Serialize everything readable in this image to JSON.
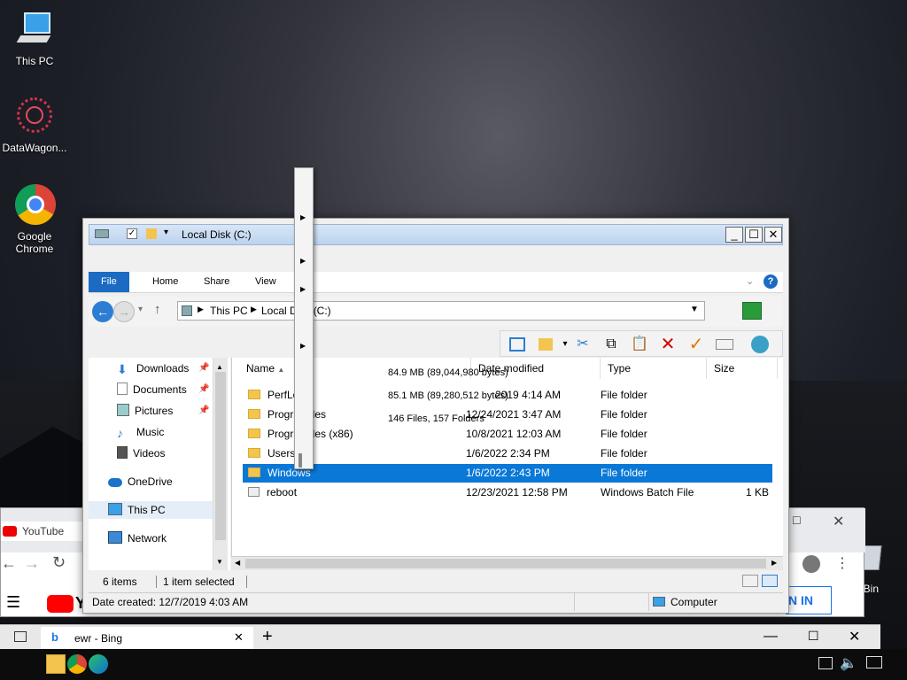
{
  "desktop": {
    "icons": [
      {
        "label": "This PC"
      },
      {
        "label": "DataWagon..."
      },
      {
        "label": "Google\nChrome"
      }
    ],
    "recycle_fragment": "le Bin"
  },
  "chrome_bg": {
    "tab_label": "YouTube",
    "signin_fragment": "N IN",
    "youtube_fragment": "Y"
  },
  "bing_window": {
    "tab_label": "ewr - Bing"
  },
  "explorer": {
    "title": "Local Disk (C:)",
    "ribbon_tabs": [
      "File",
      "Home",
      "Share",
      "View"
    ],
    "breadcrumb": [
      "This PC",
      "Local Disk (C:)"
    ],
    "nav_items": [
      {
        "label": "Downloads",
        "pinned": true,
        "icon": "download-icon"
      },
      {
        "label": "Documents",
        "pinned": true,
        "icon": "documents-icon"
      },
      {
        "label": "Pictures",
        "pinned": true,
        "icon": "pictures-icon"
      },
      {
        "label": "Music",
        "pinned": false,
        "icon": "music-icon"
      },
      {
        "label": "Videos",
        "pinned": false,
        "icon": "videos-icon"
      },
      {
        "label": "OneDrive",
        "pinned": false,
        "icon": "cloud-icon"
      },
      {
        "label": "This PC",
        "pinned": false,
        "icon": "computer-icon"
      },
      {
        "label": "Network",
        "pinned": false,
        "icon": "network-icon"
      }
    ],
    "columns": [
      "Name",
      "Date modified",
      "Type",
      "Size"
    ],
    "files": [
      {
        "name": "PerfLo",
        "date": "2019 4:14 AM",
        "type": "File folder",
        "size": ""
      },
      {
        "name": "Progra",
        "name_tail": "iles",
        "date": "12/24/2021 3:47 AM",
        "type": "File folder",
        "size": ""
      },
      {
        "name": "Progra",
        "name_tail": "iles (x86)",
        "date": "10/8/2021 12:03 AM",
        "type": "File folder",
        "size": ""
      },
      {
        "name": "Users",
        "date": "1/6/2022 2:34 PM",
        "type": "File folder",
        "size": ""
      },
      {
        "name": "Windows",
        "date": "1/6/2022 2:43 PM",
        "type": "File folder",
        "size": "",
        "selected": true
      },
      {
        "name": "reboot",
        "date": "12/23/2021 12:58 PM",
        "type": "Windows Batch File",
        "size": "1 KB"
      }
    ],
    "tooltips": [
      "84.9 MB (89,044,980 bytes)",
      "85.1 MB (89,280,512 bytes)",
      "146 Files, 157 Folders"
    ],
    "date_header_fragment": "Date modified",
    "status": {
      "count": "6 items",
      "selection": "1 item selected"
    },
    "detail_status": {
      "created": "Date created: 12/7/2019 4:03 AM",
      "location": "Computer"
    }
  },
  "colors": {
    "accent": "#1a6bc1",
    "selection": "#0a78d7"
  }
}
